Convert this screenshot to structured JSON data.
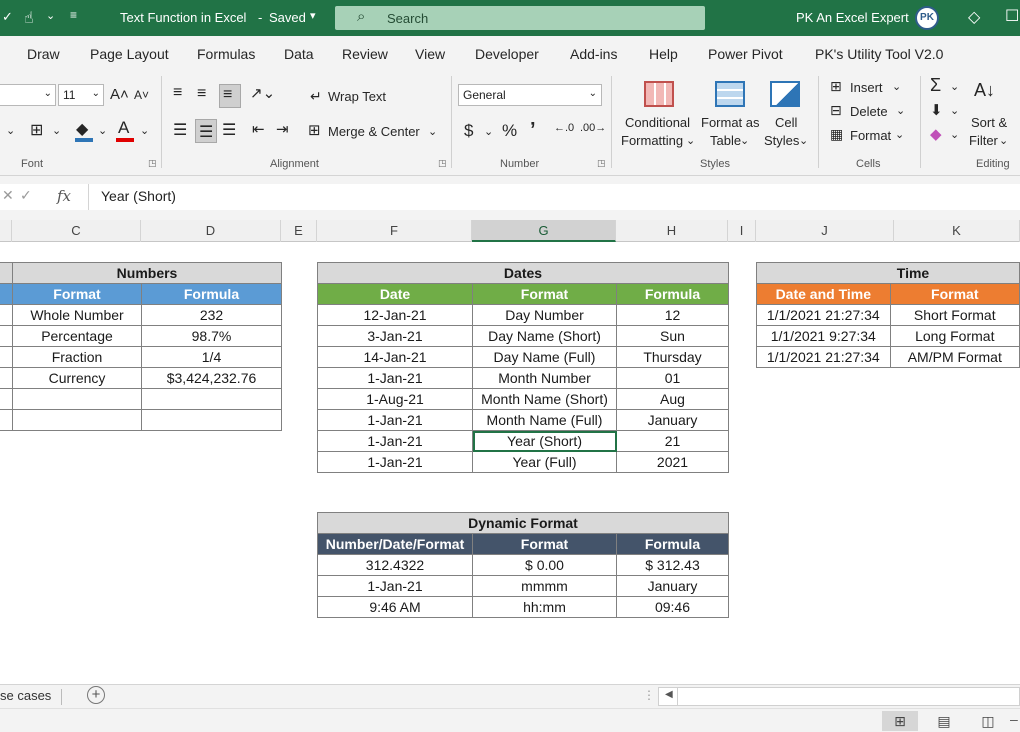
{
  "titlebar": {
    "doc_title": "Text Function in Excel",
    "saved_status": "Saved",
    "search_placeholder": "Search",
    "user_name": "PK An Excel Expert",
    "avatar_text": "PK",
    "bar_color": "#217346"
  },
  "tabs": [
    "Draw",
    "Page Layout",
    "Formulas",
    "Data",
    "Review",
    "View",
    "Developer",
    "Add-ins",
    "Help",
    "Power Pivot",
    "PK's Utility Tool V2.0"
  ],
  "ribbon": {
    "font_size": "11",
    "number_format": "General",
    "wrap_text": "Wrap Text",
    "merge_center": "Merge & Center",
    "conditional_formatting": [
      "Conditional",
      "Formatting"
    ],
    "format_as_table": [
      "Format as",
      "Table"
    ],
    "cell_styles": [
      "Cell",
      "Styles"
    ],
    "insert": "Insert",
    "delete": "Delete",
    "format": "Format",
    "sort_filter": [
      "Sort &",
      "Filter"
    ],
    "groups": {
      "font": "Font",
      "alignment": "Alignment",
      "number": "Number",
      "styles": "Styles",
      "cells": "Cells",
      "editing": "Editing"
    },
    "currency_symbol": "$",
    "percent_symbol": "%",
    "comma_symbol": "’",
    "autosum_symbol": "Σ"
  },
  "formula_bar": {
    "fx": "fx",
    "content": "Year (Short)"
  },
  "columns": [
    "C",
    "D",
    "E",
    "F",
    "G",
    "H",
    "I",
    "J",
    "K"
  ],
  "numbers_table": {
    "title": "Numbers",
    "headers": [
      "Format",
      "Formula"
    ],
    "rows": [
      [
        "Whole Number",
        "232"
      ],
      [
        "Percentage",
        "98.7%"
      ],
      [
        "Fraction",
        "1/4"
      ],
      [
        "Currency",
        "$3,424,232.76"
      ],
      [
        "",
        ""
      ],
      [
        "",
        ""
      ]
    ]
  },
  "dates_table": {
    "title": "Dates",
    "headers": [
      "Date",
      "Format",
      "Formula"
    ],
    "rows": [
      [
        "12-Jan-21",
        "Day Number",
        "12"
      ],
      [
        "3-Jan-21",
        "Day Name (Short)",
        "Sun"
      ],
      [
        "14-Jan-21",
        "Day Name (Full)",
        "Thursday"
      ],
      [
        "1-Jan-21",
        "Month Number",
        "01"
      ],
      [
        "1-Aug-21",
        "Month Name (Short)",
        "Aug"
      ],
      [
        "1-Jan-21",
        "Month Name (Full)",
        "January"
      ],
      [
        "1-Jan-21",
        "Year (Short)",
        "21"
      ],
      [
        "1-Jan-21",
        "Year (Full)",
        "2021"
      ]
    ]
  },
  "time_table": {
    "title": "Time",
    "headers": [
      "Date and Time",
      "Format"
    ],
    "rows": [
      [
        "1/1/2021 21:27:34",
        "Short Format"
      ],
      [
        "1/1/2021 9:27:34",
        "Long Format"
      ],
      [
        "1/1/2021 21:27:34",
        "AM/PM Format"
      ]
    ]
  },
  "dynamic_table": {
    "title": "Dynamic Format",
    "headers": [
      "Number/Date/Format",
      "Format",
      "Formula"
    ],
    "rows": [
      [
        "312.4322",
        "$ 0.00",
        "$ 312.43"
      ],
      [
        "1-Jan-21",
        "mmmm",
        "January"
      ],
      [
        "9:46 AM",
        "hh:mm",
        "09:46"
      ]
    ]
  },
  "sheet_tab": "se cases",
  "colors": {
    "blue_header": "#5b9bd5",
    "green_header": "#70ad47",
    "orange_header": "#ed7d31",
    "slate_header": "#44546a",
    "title_gray": "#d9d9d9"
  }
}
